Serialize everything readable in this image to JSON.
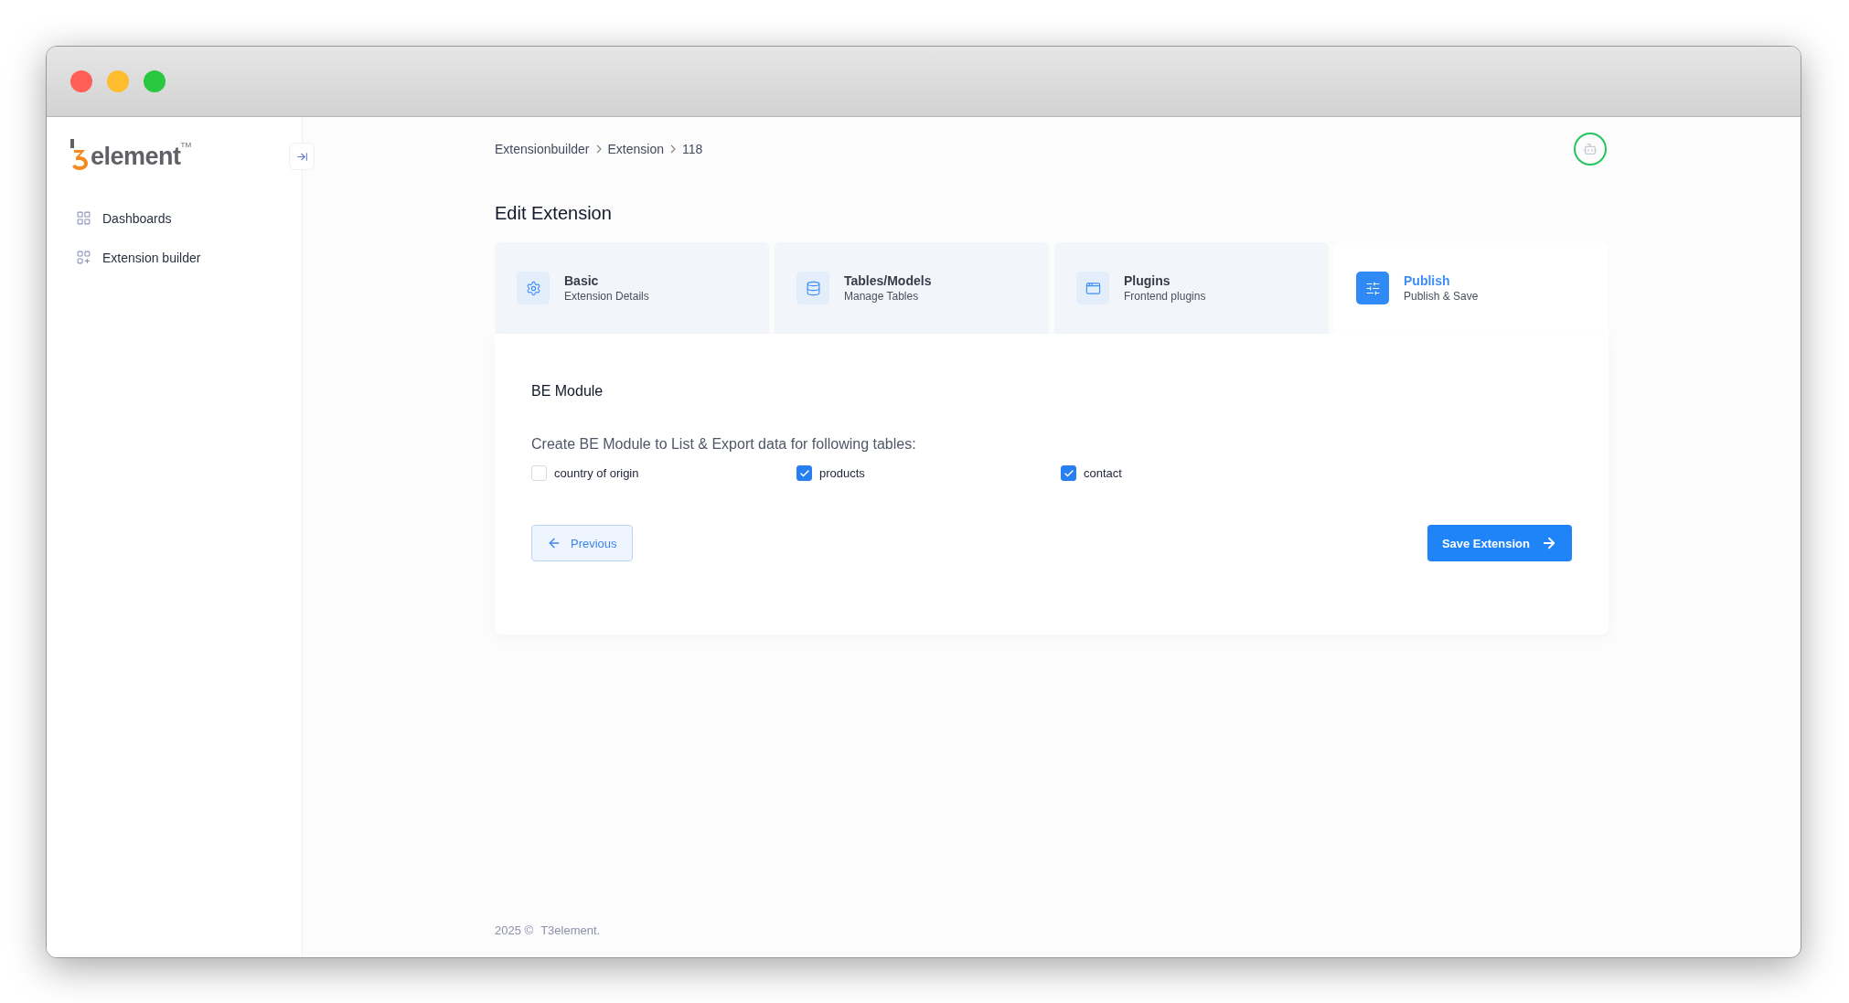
{
  "window": {
    "controls": [
      {
        "color": "#ff5f57"
      },
      {
        "color": "#febc2e"
      },
      {
        "color": "#28c840"
      }
    ]
  },
  "sidebar": {
    "logo": {
      "text": "element",
      "trademark": "TM"
    },
    "items": [
      {
        "label": "Dashboards",
        "selected": false
      },
      {
        "label": "Extension builder",
        "selected": false
      }
    ]
  },
  "breadcrumb": [
    "Extensionbuilder",
    "Extension",
    "118"
  ],
  "page_title": "Edit Extension",
  "steps": [
    {
      "title": "Basic",
      "subtitle": "Extension Details",
      "selected": false
    },
    {
      "title": "Tables/Models",
      "subtitle": "Manage Tables",
      "selected": false
    },
    {
      "title": "Plugins",
      "subtitle": "Frontend plugins",
      "selected": false
    },
    {
      "title": "Publish",
      "subtitle": "Publish & Save",
      "selected": true
    }
  ],
  "section": {
    "title": "BE Module",
    "description": "Create BE Module to List & Export data for following tables:",
    "tables": [
      {
        "label": "country of origin",
        "checked": false
      },
      {
        "label": "products",
        "checked": true
      },
      {
        "label": "contact",
        "checked": true
      }
    ]
  },
  "buttons": {
    "previous": "Previous",
    "save": "Save Extension"
  },
  "footer": {
    "year": "2025 ©",
    "company": "T3element."
  }
}
